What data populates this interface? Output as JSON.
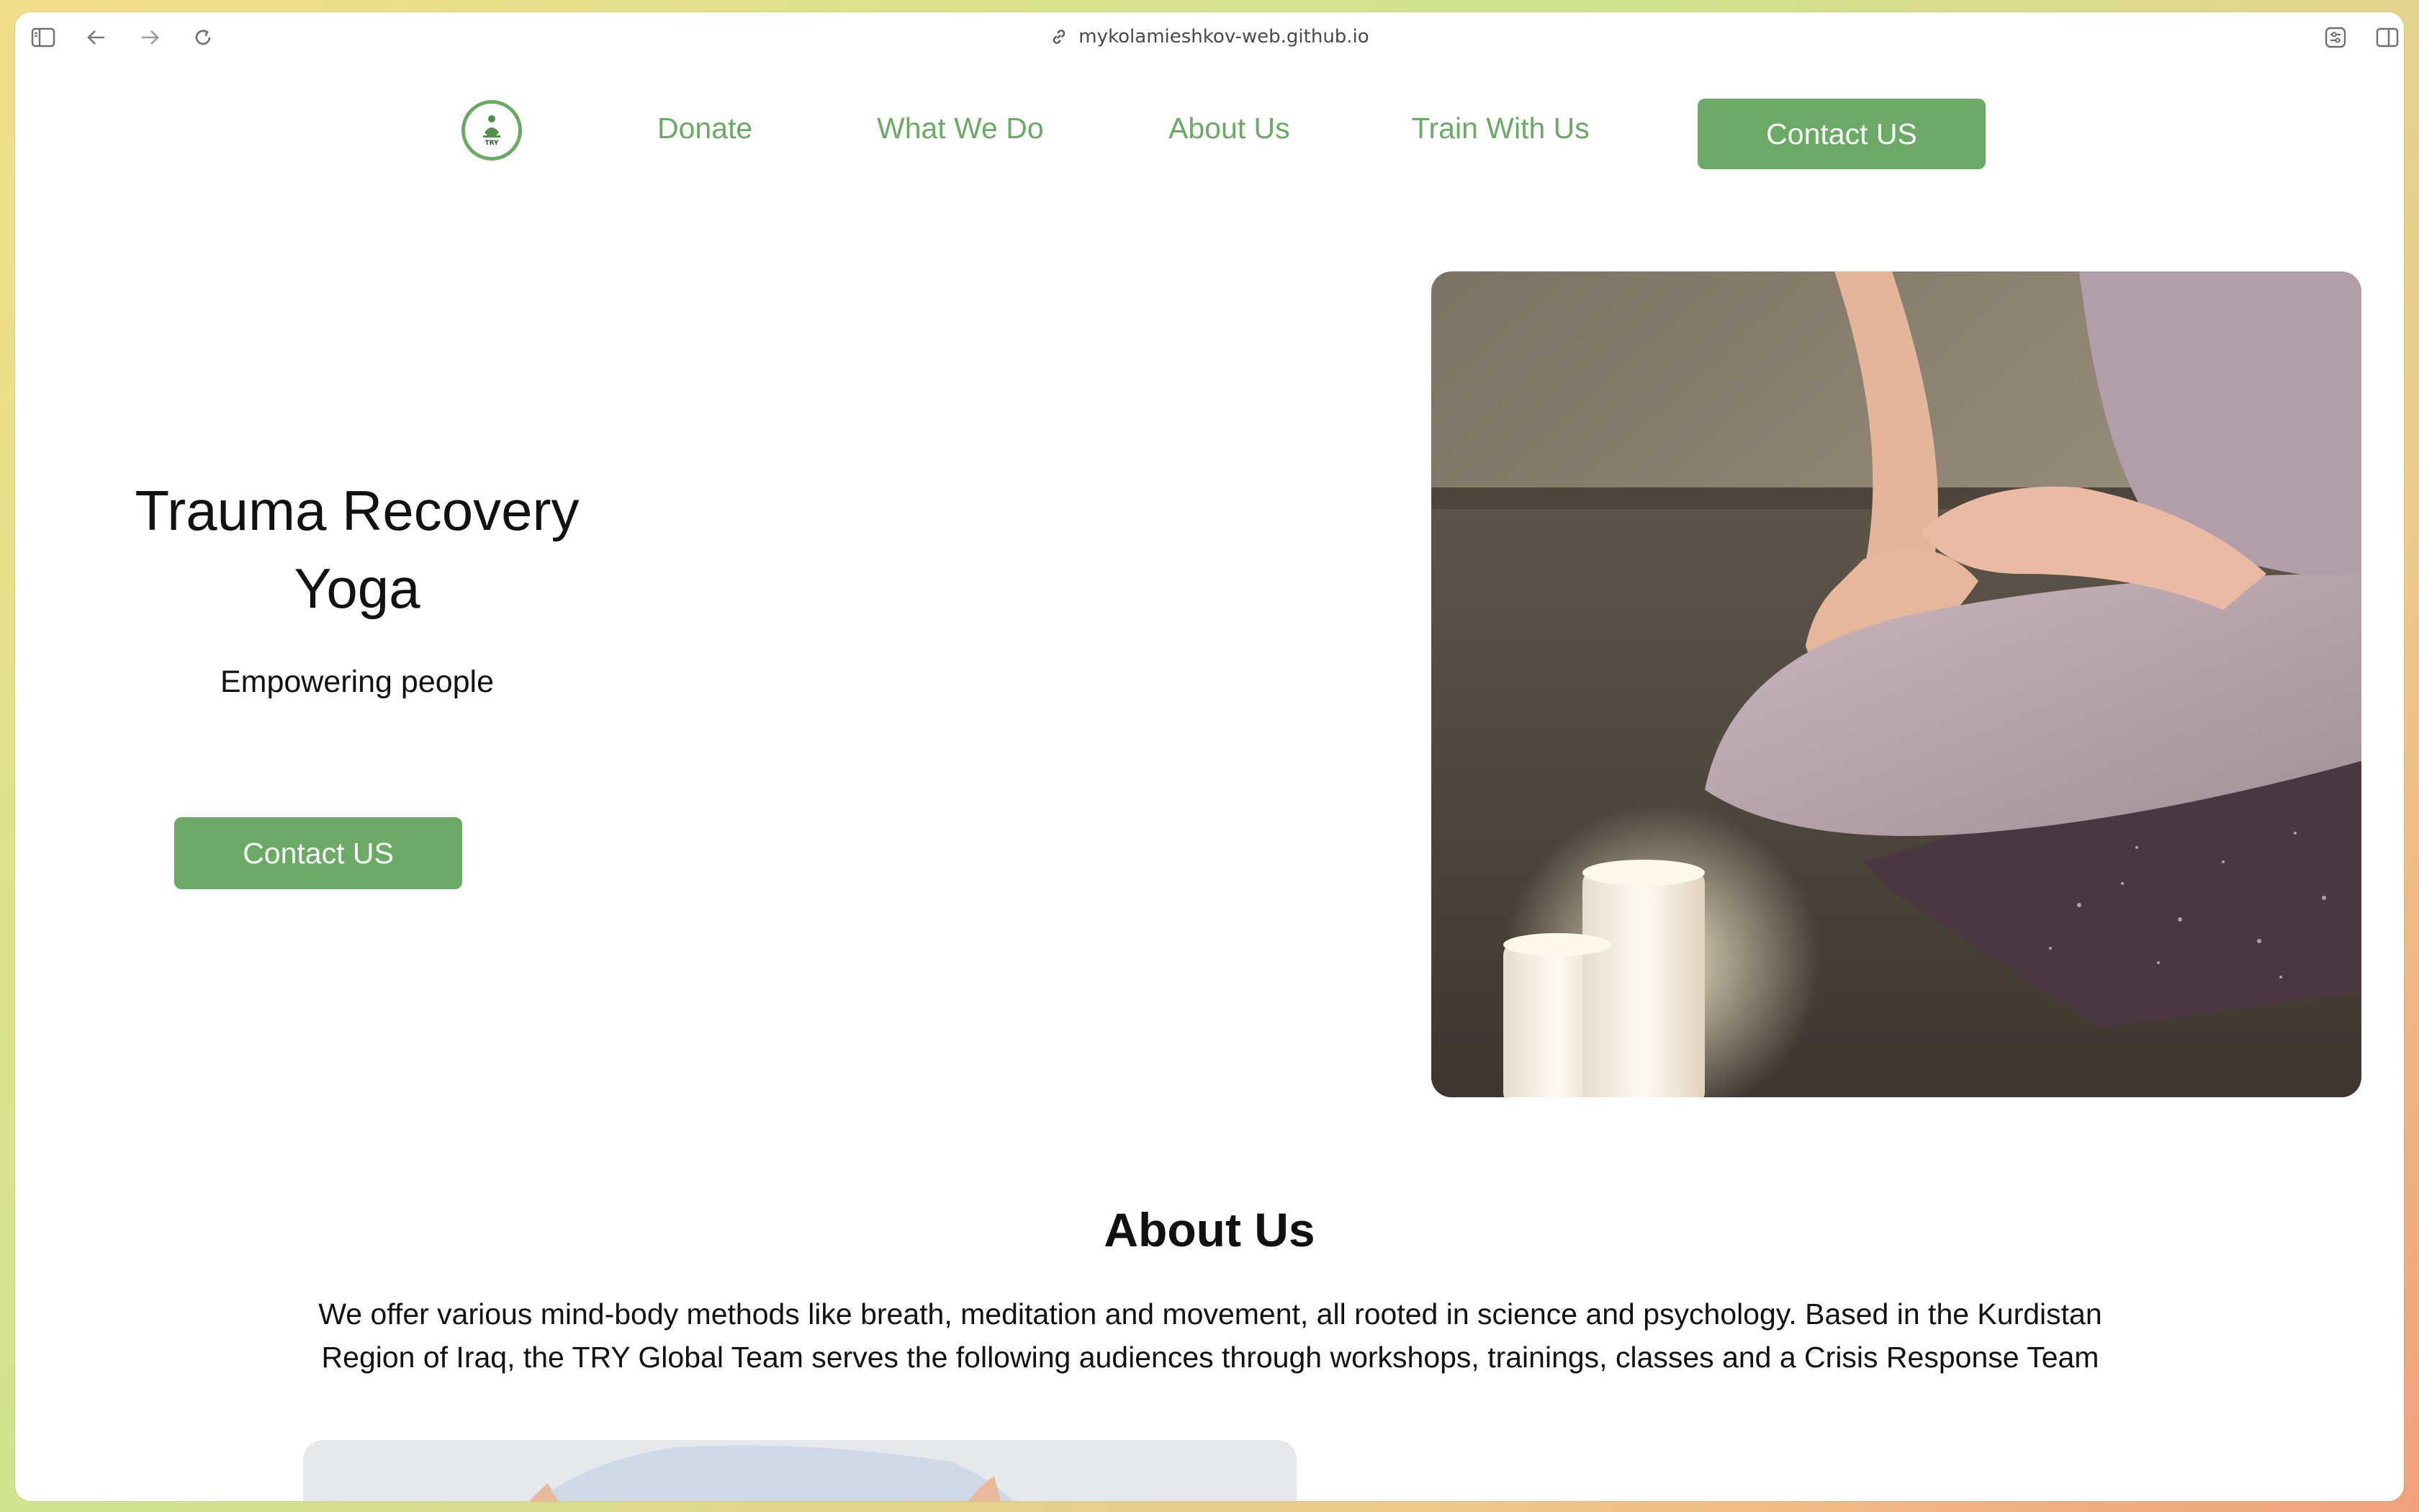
{
  "browser": {
    "url": "mykolamieshkov-web.github.io"
  },
  "nav": {
    "logo_text": "TRY",
    "links": [
      "Donate",
      "What We Do",
      "About Us",
      "Train With Us"
    ],
    "cta_label": "Contact US"
  },
  "hero": {
    "title_line1": "Trauma Recovery",
    "title_line2": "Yoga",
    "subtitle": "Empowering people",
    "cta_label": "Contact US"
  },
  "about": {
    "title": "About Us",
    "text_line1": "We offer various mind-body methods like breath, meditation and movement, all rooted in science and psychology. Based in the Kurdistan",
    "text_line2": "Region of Iraq, the TRY Global Team serves the following audiences through workshops, trainings, classes and a Crisis Response Team"
  },
  "colors": {
    "accent": "#6aaa64",
    "text": "#111111",
    "background": "#ffffff"
  },
  "icons": {
    "sidebar": "sidebar-icon",
    "back": "back-arrow-icon",
    "forward": "forward-arrow-icon",
    "reload": "reload-icon",
    "link": "link-icon",
    "extensions": "extension-icon",
    "split": "split-view-icon"
  }
}
